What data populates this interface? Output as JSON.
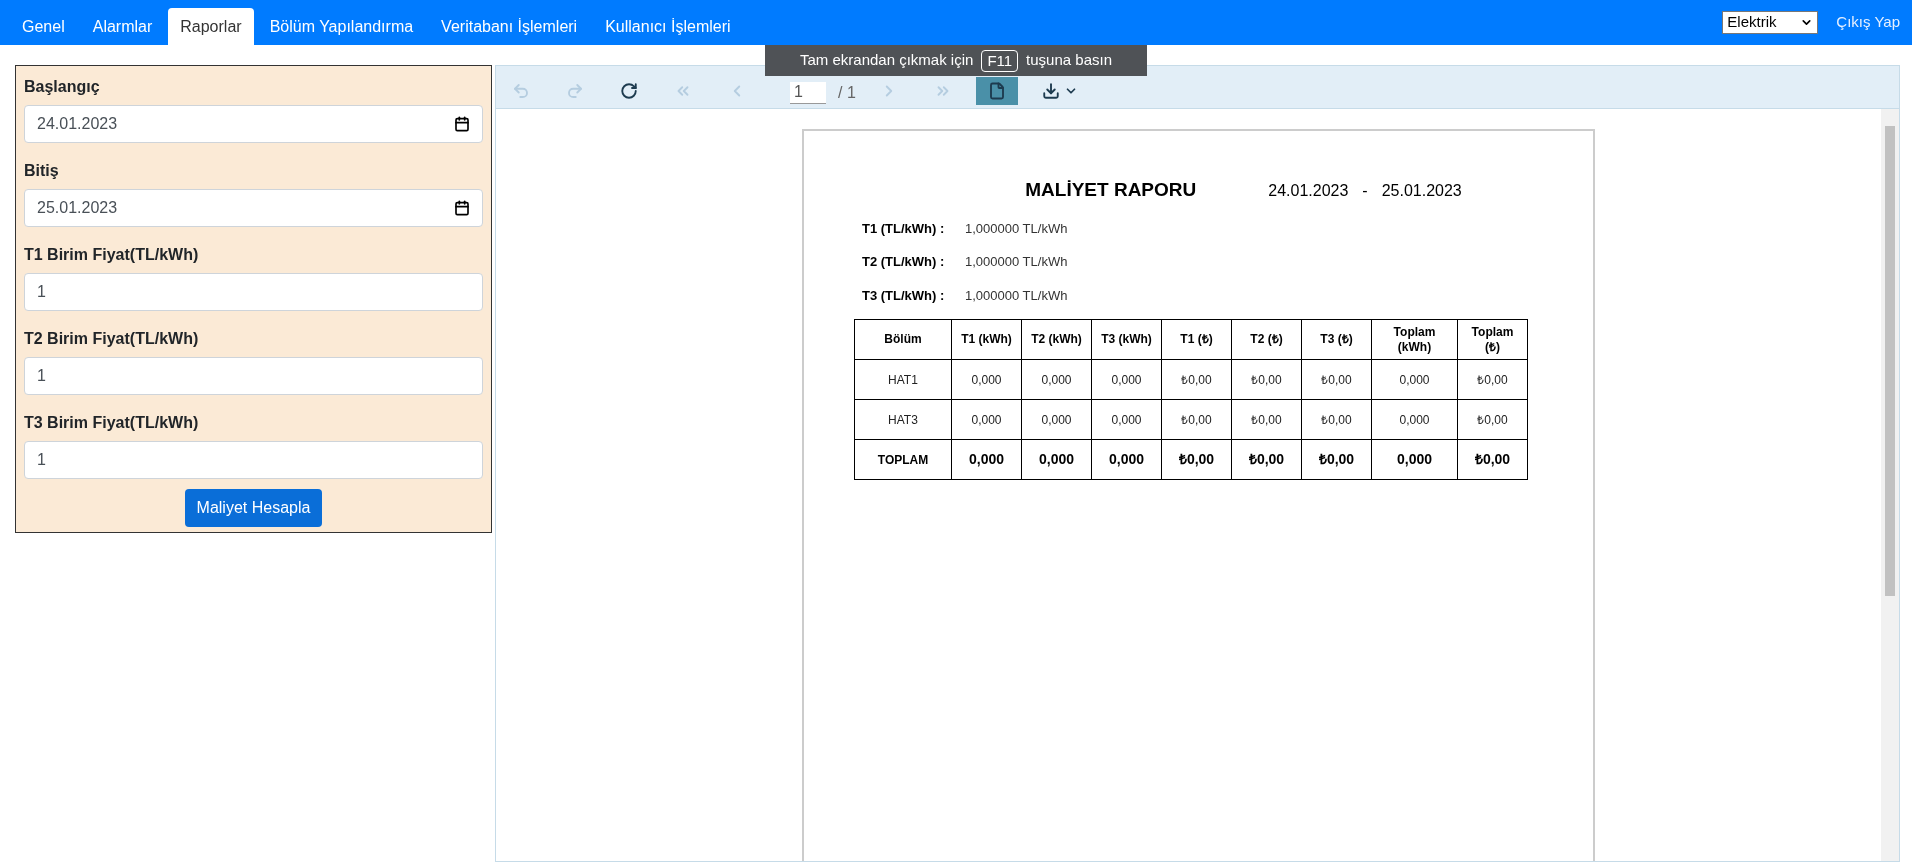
{
  "nav": {
    "tabs": [
      {
        "label": "Genel",
        "selected": false
      },
      {
        "label": "Alarmlar",
        "selected": false
      },
      {
        "label": "Raporlar",
        "selected": true
      },
      {
        "label": "Bölüm Yapılandırma",
        "selected": false
      },
      {
        "label": "Veritabanı İşlemleri",
        "selected": false
      },
      {
        "label": "Kullanıcı İşlemleri",
        "selected": false
      }
    ],
    "meter_select": {
      "value": "Elektrik"
    },
    "logout": "Çıkış Yap"
  },
  "form": {
    "fields": [
      {
        "label": "Başlangıç",
        "kind": "date",
        "value": "24.01.2023"
      },
      {
        "label": "Bitiş",
        "kind": "date",
        "value": "25.01.2023"
      },
      {
        "label": "T1 Birim Fiyat(TL/kWh)",
        "kind": "number",
        "value": "1"
      },
      {
        "label": "T2 Birim Fiyat(TL/kWh)",
        "kind": "number",
        "value": "1"
      },
      {
        "label": "T3 Birim Fiyat(TL/kWh)",
        "kind": "number",
        "value": "1"
      }
    ],
    "submit": "Maliyet Hesapla"
  },
  "viewer": {
    "toolbar": {
      "buttons": [
        {
          "kind": "undo",
          "disabled": true
        },
        {
          "kind": "redo",
          "disabled": true
        },
        {
          "kind": "refresh",
          "disabled": false
        },
        {
          "kind": "first",
          "disabled": true
        },
        {
          "kind": "prev",
          "disabled": true
        }
      ],
      "page_input": "1",
      "page_count": "/ 1",
      "right_buttons": [
        {
          "kind": "next",
          "disabled": true
        },
        {
          "kind": "last",
          "disabled": true
        },
        {
          "kind": "document",
          "disabled": false,
          "selected": true
        },
        {
          "kind": "download",
          "disabled": false,
          "selected": false
        }
      ]
    },
    "fullscreen_hint": {
      "before": "Tam ekrandan çıkmak için",
      "key": "F11",
      "after": "tuşuna basın"
    },
    "report": {
      "title": "MALİYET RAPORU",
      "start": "24.01.2023",
      "separator": "-",
      "end": "25.01.2023",
      "rates": [
        {
          "label": "T1 (TL/kWh) :",
          "value": "1,000000 TL/kWh"
        },
        {
          "label": "T2 (TL/kWh) :",
          "value": "1,000000 TL/kWh"
        },
        {
          "label": "T3 (TL/kWh) :",
          "value": "1,000000 TL/kWh"
        }
      ],
      "table": {
        "columns": [
          "Bölüm",
          "T1 (kWh)",
          "T2 (kWh)",
          "T3 (kWh)",
          "T1 (₺)",
          "T2 (₺)",
          "T3 (₺)",
          "Toplam (kWh)",
          "Toplam (₺)"
        ],
        "rows": [
          {
            "kind": "data",
            "cells": [
              "HAT1",
              "0,000",
              "0,000",
              "0,000",
              "₺0,00",
              "₺0,00",
              "₺0,00",
              "0,000",
              "₺0,00"
            ]
          },
          {
            "kind": "data",
            "cells": [
              "HAT3",
              "0,000",
              "0,000",
              "0,000",
              "₺0,00",
              "₺0,00",
              "₺0,00",
              "0,000",
              "₺0,00"
            ]
          },
          {
            "kind": "total",
            "cells": [
              "TOPLAM",
              "0,000",
              "0,000",
              "0,000",
              "₺0,00",
              "₺0,00",
              "₺0,00",
              "0,000",
              "₺0,00"
            ]
          }
        ]
      }
    }
  }
}
